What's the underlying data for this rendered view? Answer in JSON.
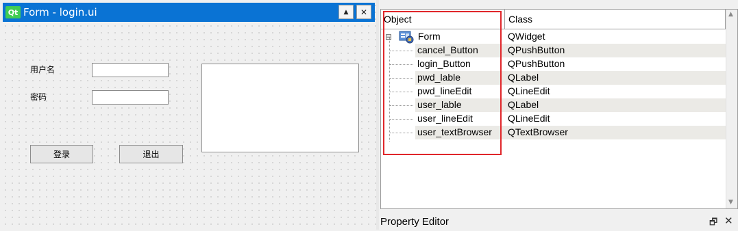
{
  "form_window": {
    "logo_text": "Qt",
    "title": "Form - login.ui",
    "max_glyph": "▲",
    "close_glyph": "✕"
  },
  "form": {
    "user_label": "用户名",
    "pwd_label": "密码",
    "user_input_value": "",
    "pwd_input_value": "",
    "login_button": "登录",
    "cancel_button": "退出"
  },
  "object_inspector": {
    "columns": [
      "Object",
      "Class"
    ],
    "rows": [
      {
        "object": "Form",
        "class": "QWidget",
        "level": 0
      },
      {
        "object": "cancel_Button",
        "class": "QPushButton",
        "level": 1
      },
      {
        "object": "login_Button",
        "class": "QPushButton",
        "level": 1
      },
      {
        "object": "pwd_lable",
        "class": "QLabel",
        "level": 1
      },
      {
        "object": "pwd_lineEdit",
        "class": "QLineEdit",
        "level": 1
      },
      {
        "object": "user_lable",
        "class": "QLabel",
        "level": 1
      },
      {
        "object": "user_lineEdit",
        "class": "QLineEdit",
        "level": 1
      },
      {
        "object": "user_textBrowser",
        "class": "QTextBrowser",
        "level": 1
      }
    ],
    "expand_glyph": "⊟",
    "scroll_up_glyph": "▲",
    "scroll_down_glyph": "▼"
  },
  "property_editor": {
    "title": "Property Editor",
    "float_glyph": "🗗",
    "close_glyph": "✕"
  },
  "colors": {
    "titlebar": "#0a73d4",
    "qt_green": "#41cd52",
    "highlight": "#e0262a",
    "alt_row": "#ebeae6"
  }
}
